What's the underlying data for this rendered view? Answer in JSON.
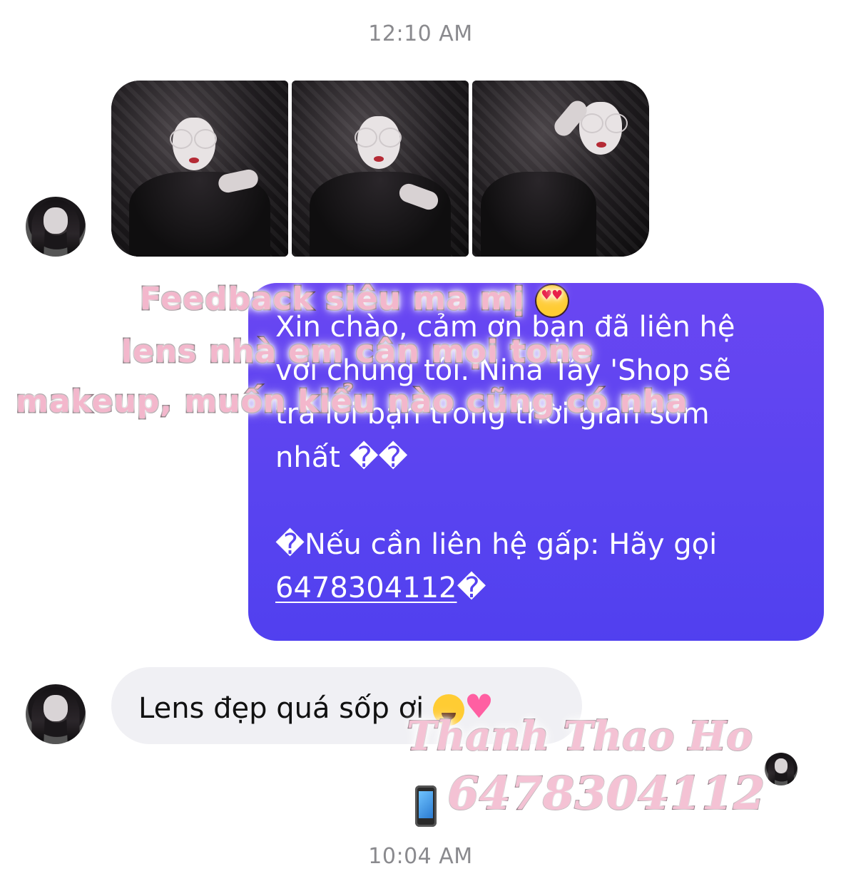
{
  "chat": {
    "timestamp_top": "12:10 AM",
    "timestamp_bottom": "10:04 AM",
    "purple_bubble": {
      "line1": "Xin chào, cảm ơn bạn đã liên hệ",
      "line2": "với chúng tôi. Nina Tây 'Shop sẽ",
      "line3": "trả lời bạn trong thời gian sớm",
      "line4": "nhất ��",
      "line5_prefix": "�Nếu cần liên hệ gấp: Hãy gọi",
      "phone": "6478304112",
      "phone_suffix": "�"
    },
    "gray_bubble": {
      "text": "Lens đẹp quá sốp ơi"
    }
  },
  "overlay": {
    "line1": "Feedback siêu ma mị",
    "line2": "lens nhà em cân mọi tone",
    "line3": "makeup, muốn kiểu nào cũng có nha"
  },
  "signature": {
    "name": "Thanh Thao Ho",
    "phone": "6478304112"
  },
  "icons": {
    "heart_eyes": "heart-eyes-emoji",
    "crying": "loudly-crying-emoji",
    "pink_heart": "growing-heart-emoji",
    "phone": "mobile-phone-emoji"
  },
  "colors": {
    "bubble_purple": "#5a44f0",
    "bubble_gray": "#f0f0f4",
    "timestamp": "#8a8a8e",
    "overlay_pink": "#f3b7cc"
  }
}
